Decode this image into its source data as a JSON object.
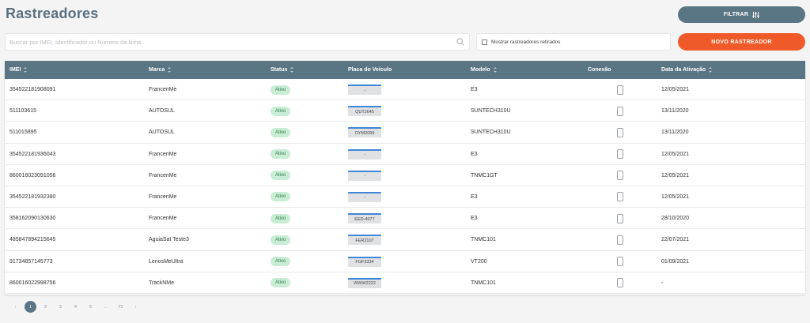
{
  "header": {
    "title": "Rastreadores",
    "filter_label": "FILTRAR",
    "new_label": "NOVO RASTREADOR"
  },
  "search": {
    "placeholder": "Buscar por IMEI, Identificador ou Número da linha",
    "value": ""
  },
  "show_retired": {
    "label": "Mostrar rastreadores retirados",
    "checked": false
  },
  "table": {
    "columns": [
      "IMEI",
      "Marca",
      "Status",
      "Placa do Veículo",
      "Modelo",
      "Conexão",
      "Data da Ativação"
    ],
    "rows": [
      {
        "imei": "354522181908091",
        "marca": "FrancenMe",
        "status": "Ativo",
        "placa": "-",
        "modelo": "E3",
        "data": "12/05/2021"
      },
      {
        "imei": "511103615",
        "marca": "AUTOSUL",
        "status": "Ativo",
        "placa": "QUT2645",
        "modelo": "SUNTECH310U",
        "data": "13/11/2020"
      },
      {
        "imei": "511015895",
        "marca": "AUTOSUL",
        "status": "Ativo",
        "placa": "OYM2099",
        "modelo": "SUNTECH310U",
        "data": "13/11/2020"
      },
      {
        "imei": "354522181936043",
        "marca": "FrancenMe",
        "status": "Ativo",
        "placa": "-",
        "modelo": "E3",
        "data": "12/05/2021"
      },
      {
        "imei": "860016023091056",
        "marca": "FrancenMe",
        "status": "Ativo",
        "placa": "-",
        "modelo": "TNMC1GT",
        "data": "12/05/2021"
      },
      {
        "imei": "354522181932380",
        "marca": "FrancenMe",
        "status": "Ativo",
        "placa": "-",
        "modelo": "E3",
        "data": "12/05/2021"
      },
      {
        "imei": "358162090130630",
        "marca": "FrancenMe",
        "status": "Ativo",
        "placa": "EED-4077",
        "modelo": "E3",
        "data": "28/10/2020"
      },
      {
        "imei": "485847894215645",
        "marca": "AguiaSat Teste3",
        "status": "Ativo",
        "placa": "FER2107",
        "modelo": "TNMC101",
        "data": "22/07/2021"
      },
      {
        "imei": "91734857145773",
        "marca": "LenosMeUltra",
        "status": "Ativo",
        "placa": "FGF2334",
        "modelo": "VT200",
        "data": "01/09/2021"
      },
      {
        "imei": "860016022998756",
        "marca": "TrackNMe",
        "status": "Ativo",
        "placa": "WWW2222",
        "modelo": "TNMC101",
        "data": "-"
      }
    ]
  },
  "pagination": {
    "prev": "‹",
    "pages": [
      "1",
      "2",
      "3",
      "4",
      "5",
      "...",
      "71"
    ],
    "next": "›",
    "current": "1"
  },
  "colors": {
    "primary": "#5a7583",
    "accent": "#f05a28",
    "status_active": "#c9ecd4",
    "plate_stripe": "#3f86d6"
  }
}
